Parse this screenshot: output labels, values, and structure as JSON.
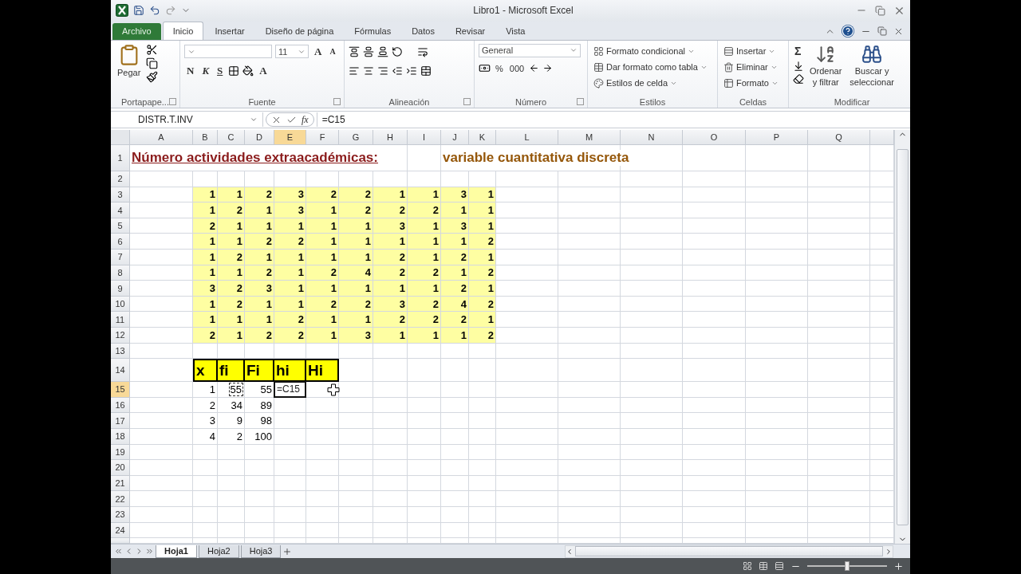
{
  "window": {
    "title": "Libro1 - Microsoft Excel"
  },
  "ribbon_tabs": [
    {
      "label": "Archivo",
      "kind": "file",
      "selected": false
    },
    {
      "label": "Inicio",
      "kind": "tab",
      "selected": true
    },
    {
      "label": "Insertar",
      "kind": "tab",
      "selected": false
    },
    {
      "label": "Diseño de página",
      "kind": "tab",
      "selected": false
    },
    {
      "label": "Fórmulas",
      "kind": "tab",
      "selected": false
    },
    {
      "label": "Datos",
      "kind": "tab",
      "selected": false
    },
    {
      "label": "Revisar",
      "kind": "tab",
      "selected": false
    },
    {
      "label": "Vista",
      "kind": "tab",
      "selected": false
    }
  ],
  "ribbon": {
    "clipboard": {
      "label": "Portapape...",
      "paste": "Pegar"
    },
    "font": {
      "label": "Fuente",
      "size": "11",
      "grow": "A",
      "shrink": "A",
      "styles": [
        "N",
        "K",
        "S"
      ],
      "font_color_button": "A"
    },
    "alignment": {
      "label": "Alineación"
    },
    "number": {
      "label": "Número",
      "format": "General",
      "percent": "%",
      "thousands": "000"
    },
    "styles": {
      "label": "Estilos",
      "items": [
        "Formato condicional",
        "Dar formato como tabla",
        "Estilos de celda"
      ]
    },
    "cells": {
      "label": "Celdas",
      "items": [
        "Insertar",
        "Eliminar",
        "Formato"
      ]
    },
    "editing": {
      "label": "Modificar",
      "sum": "Σ",
      "sort": [
        "Ordenar",
        "y filtrar"
      ],
      "find": [
        "Buscar y",
        "seleccionar"
      ]
    }
  },
  "formula_bar": {
    "name_box": "DISTR.T.INV",
    "fx": "fx",
    "formula": "=C15"
  },
  "columns": [
    {
      "label": "A",
      "selected": false
    },
    {
      "label": "B",
      "selected": false
    },
    {
      "label": "C",
      "selected": false
    },
    {
      "label": "D",
      "selected": false
    },
    {
      "label": "E",
      "selected": true
    },
    {
      "label": "F",
      "selected": false
    },
    {
      "label": "G",
      "selected": false
    },
    {
      "label": "H",
      "selected": false
    },
    {
      "label": "I",
      "selected": false
    },
    {
      "label": "J",
      "selected": false
    },
    {
      "label": "K",
      "selected": false
    },
    {
      "label": "L",
      "selected": false
    },
    {
      "label": "M",
      "selected": false
    },
    {
      "label": "N",
      "selected": false
    },
    {
      "label": "O",
      "selected": false
    },
    {
      "label": "P",
      "selected": false
    },
    {
      "label": "Q",
      "selected": false
    }
  ],
  "rows": [
    {
      "label": "1",
      "selected": false
    },
    {
      "label": "2",
      "selected": false
    },
    {
      "label": "3",
      "selected": false
    },
    {
      "label": "4",
      "selected": false
    },
    {
      "label": "5",
      "selected": false
    },
    {
      "label": "6",
      "selected": false
    },
    {
      "label": "7",
      "selected": false
    },
    {
      "label": "8",
      "selected": false
    },
    {
      "label": "9",
      "selected": false
    },
    {
      "label": "10",
      "selected": false
    },
    {
      "label": "11",
      "selected": false
    },
    {
      "label": "12",
      "selected": false
    },
    {
      "label": "13",
      "selected": false
    },
    {
      "label": "14",
      "selected": false
    },
    {
      "label": "15",
      "selected": true
    },
    {
      "label": "16",
      "selected": false
    },
    {
      "label": "17",
      "selected": false
    },
    {
      "label": "18",
      "selected": false
    },
    {
      "label": "19",
      "selected": false
    },
    {
      "label": "20",
      "selected": false
    },
    {
      "label": "21",
      "selected": false
    },
    {
      "label": "22",
      "selected": false
    },
    {
      "label": "23",
      "selected": false
    },
    {
      "label": "24",
      "selected": false
    }
  ],
  "sheet": {
    "title": "Número actividades extraacadémicas:",
    "subtitle": "variable cuantitativa discreta",
    "data": [
      [
        "1",
        "1",
        "2",
        "3",
        "2",
        "2",
        "1",
        "1",
        "3",
        "1"
      ],
      [
        "1",
        "2",
        "1",
        "3",
        "1",
        "2",
        "2",
        "2",
        "1",
        "1"
      ],
      [
        "2",
        "1",
        "1",
        "1",
        "1",
        "1",
        "3",
        "1",
        "3",
        "1"
      ],
      [
        "1",
        "1",
        "2",
        "2",
        "1",
        "1",
        "1",
        "1",
        "1",
        "2"
      ],
      [
        "1",
        "2",
        "1",
        "1",
        "1",
        "1",
        "2",
        "1",
        "2",
        "1"
      ],
      [
        "1",
        "1",
        "2",
        "1",
        "2",
        "4",
        "2",
        "2",
        "1",
        "2"
      ],
      [
        "3",
        "2",
        "3",
        "1",
        "1",
        "1",
        "1",
        "1",
        "2",
        "1"
      ],
      [
        "1",
        "2",
        "1",
        "1",
        "2",
        "2",
        "3",
        "2",
        "4",
        "2"
      ],
      [
        "1",
        "1",
        "1",
        "2",
        "1",
        "1",
        "2",
        "2",
        "2",
        "1"
      ],
      [
        "2",
        "1",
        "2",
        "2",
        "1",
        "3",
        "1",
        "1",
        "1",
        "2"
      ]
    ],
    "table": {
      "headers": [
        "x",
        "fi",
        "Fi",
        "hi",
        "Hi"
      ],
      "rows": [
        {
          "values": [
            "1",
            "55",
            "55"
          ],
          "marked": true
        },
        {
          "values": [
            "2",
            "34",
            "89"
          ],
          "marked": false
        },
        {
          "values": [
            "3",
            "9",
            "98"
          ],
          "marked": false
        },
        {
          "values": [
            "4",
            "2",
            "100"
          ],
          "marked": false
        }
      ],
      "editor": {
        "value": "=C15"
      }
    }
  },
  "sheet_tabs": [
    {
      "label": "Hoja1",
      "selected": true
    },
    {
      "label": "Hoja2",
      "selected": false
    },
    {
      "label": "Hoja3",
      "selected": false
    }
  ],
  "zoom": {
    "level": 0.5
  }
}
